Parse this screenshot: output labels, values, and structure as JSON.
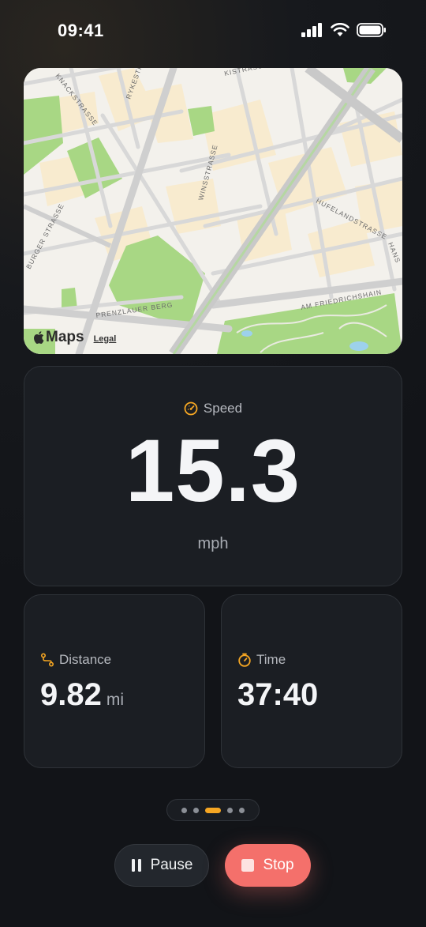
{
  "status_bar": {
    "time": "09:41"
  },
  "map": {
    "streets": [
      "KNACKSTRASSE",
      "RYKESTRA",
      "KISTRASSE",
      "WINSSTRASSE",
      "HUFELANDSTRASSE",
      "HANS",
      "BURGER STRASSE",
      "PRENZLAUER BERG",
      "AM FRIEDRICHSHAIN"
    ],
    "brand": "Maps",
    "legal": "Legal"
  },
  "speed": {
    "label": "Speed",
    "value": "15.3",
    "unit": "mph",
    "icon": "speedometer-icon"
  },
  "distance": {
    "label": "Distance",
    "value": "9.82",
    "unit": "mi",
    "icon": "route-icon"
  },
  "time": {
    "label": "Time",
    "value": "37:40",
    "icon": "timer-icon"
  },
  "pager": {
    "count": 5,
    "active_index": 2
  },
  "controls": {
    "pause_label": "Pause",
    "stop_label": "Stop"
  },
  "colors": {
    "accent": "#f5a623",
    "stop": "#f4706b",
    "card": "#1b1e23"
  }
}
